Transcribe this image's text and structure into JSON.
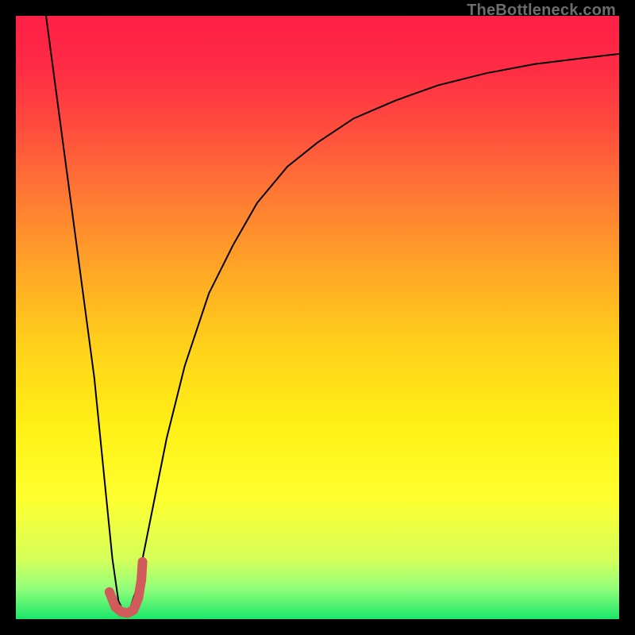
{
  "watermark": "TheBottleneck.com",
  "chart_data": {
    "type": "line",
    "title": "",
    "xlabel": "",
    "ylabel": "",
    "xlim": [
      0,
      100
    ],
    "ylim": [
      0,
      100
    ],
    "grid": false,
    "legend": false,
    "background_gradient": [
      {
        "stop": 0.0,
        "color": "#ff1f47"
      },
      {
        "stop": 0.08,
        "color": "#ff2a45"
      },
      {
        "stop": 0.18,
        "color": "#ff4a3e"
      },
      {
        "stop": 0.3,
        "color": "#ff7a33"
      },
      {
        "stop": 0.42,
        "color": "#ffa626"
      },
      {
        "stop": 0.55,
        "color": "#ffd21a"
      },
      {
        "stop": 0.68,
        "color": "#fff016"
      },
      {
        "stop": 0.8,
        "color": "#feff2e"
      },
      {
        "stop": 0.9,
        "color": "#d6ff5a"
      },
      {
        "stop": 0.95,
        "color": "#90ff7a"
      },
      {
        "stop": 1.0,
        "color": "#19e66a"
      }
    ],
    "series": [
      {
        "name": "bottleneck-curve",
        "color": "#000000",
        "stroke_width": 2,
        "x": [
          5,
          7,
          9,
          11,
          13,
          14.5,
          16,
          17,
          18,
          19,
          20,
          21,
          23,
          25,
          28,
          32,
          36,
          40,
          45,
          50,
          56,
          63,
          70,
          78,
          86,
          94,
          100
        ],
        "values": [
          100,
          85,
          70,
          55,
          40,
          25,
          10,
          3,
          1,
          2,
          5,
          10,
          20,
          30,
          42,
          54,
          62,
          69,
          75,
          79,
          83,
          86,
          88.5,
          90.5,
          92,
          93,
          93.7
        ]
      },
      {
        "name": "optimal-marker",
        "color": "#d15a5a",
        "stroke_width": 12,
        "stroke_linecap": "round",
        "x": [
          15.5,
          16.5,
          17.5,
          18.5,
          19.5,
          20.3,
          20.8,
          21.0
        ],
        "values": [
          4.5,
          2.0,
          1.2,
          1.0,
          1.5,
          3.5,
          6.5,
          9.5
        ]
      }
    ]
  }
}
